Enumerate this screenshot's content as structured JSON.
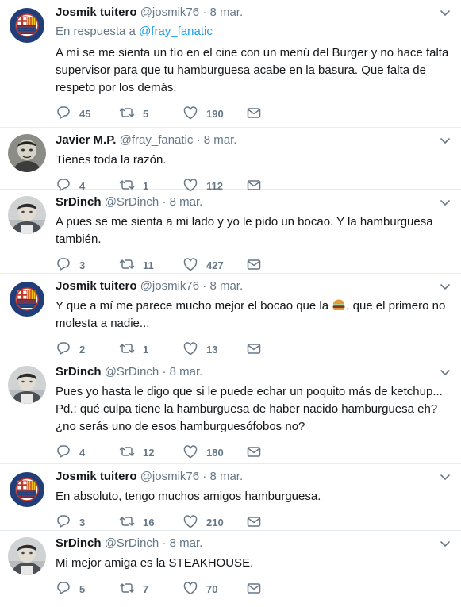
{
  "tweets": [
    {
      "name": "Josmik tuitero",
      "handle": "@josmik76",
      "time": "· 8 mar.",
      "reply_prefix": "En respuesta a ",
      "reply_handle": "@fray_fanatic",
      "text": "A mí se me sienta un tío en el cine con un menú del Burger y no hace falta supervisor para que tu hamburguesa acabe en la basura. Que falta de respeto por los demás.",
      "replies": "45",
      "retweets": "5",
      "likes": "190"
    },
    {
      "name": "Javier M.P.",
      "handle": "@fray_fanatic",
      "time": "· 8 mar.",
      "text": "Tienes toda la razón.",
      "replies": "4",
      "retweets": "1",
      "likes": "112"
    },
    {
      "name": "SrDinch",
      "handle": "@SrDinch",
      "time": "· 8 mar.",
      "text": "A pues se me sienta a mi lado y yo le pido un bocao. Y la hamburguesa también.",
      "replies": "3",
      "retweets": "11",
      "likes": "427"
    },
    {
      "name": "Josmik tuitero",
      "handle": "@josmik76",
      "time": "· 8 mar.",
      "text_before": "Y que a mí me parece mucho mejor el bocao que la ",
      "text_after": ", que el primero no molesta a nadie...",
      "replies": "2",
      "retweets": "1",
      "likes": "13"
    },
    {
      "name": "SrDinch",
      "handle": "@SrDinch",
      "time": "· 8 mar.",
      "text": "Pues yo hasta le digo que si le puede echar un poquito más de ketchup... Pd.: qué culpa tiene la hamburguesa de haber nacido hamburguesa eh? ¿no serás uno de esos hamburguesófobos no?",
      "replies": "4",
      "retweets": "12",
      "likes": "180"
    },
    {
      "name": "Josmik tuitero",
      "handle": "@josmik76",
      "time": "· 8 mar.",
      "text": "En absoluto, tengo muchos amigos hamburguesa.",
      "replies": "3",
      "retweets": "16",
      "likes": "210"
    },
    {
      "name": "SrDinch",
      "handle": "@SrDinch",
      "time": "· 8 mar.",
      "text": "Mi mejor amiga es la STEAKHOUSE.",
      "replies": "5",
      "retweets": "7",
      "likes": "70"
    }
  ],
  "avatar_badge_text": "BARCELONA",
  "colors": {
    "link": "#1da1f2",
    "muted": "#657786",
    "border": "#e6ecf0"
  }
}
